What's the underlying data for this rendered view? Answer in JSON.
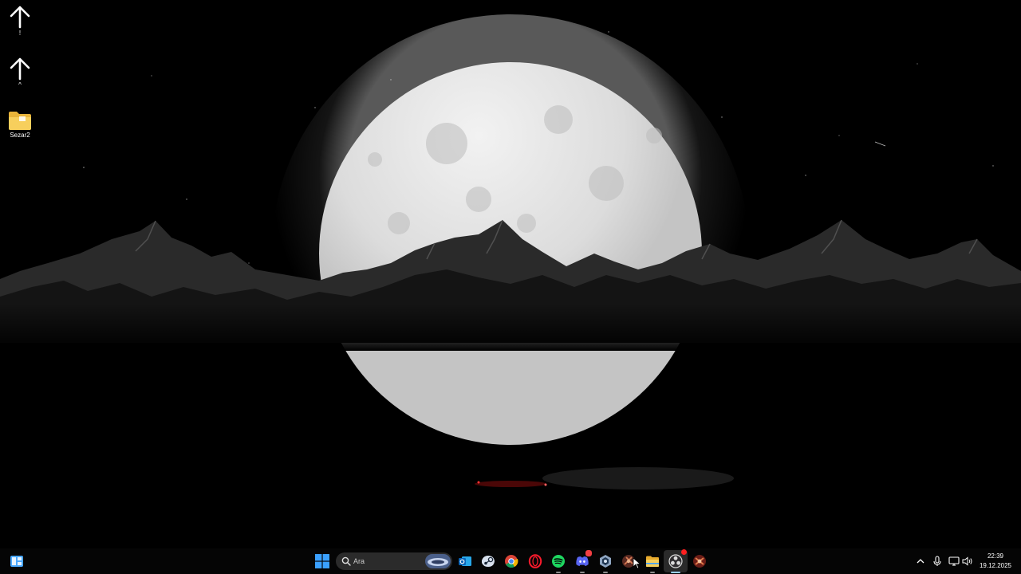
{
  "desktop": {
    "icons": [
      {
        "name": "upload-shortcut-1",
        "label": "!"
      },
      {
        "name": "upload-shortcut-2",
        "label": "^"
      },
      {
        "name": "folder",
        "label": "Sezar2"
      }
    ]
  },
  "taskbar": {
    "search": {
      "placeholder": "Ara"
    },
    "apps": [
      {
        "icon": "start-windows-icon",
        "running": false
      },
      {
        "icon": "outlook-icon",
        "running": false
      },
      {
        "icon": "steam-icon",
        "running": false
      },
      {
        "icon": "chrome-icon",
        "running": false
      },
      {
        "icon": "opera-gx-icon",
        "running": false
      },
      {
        "icon": "spotify-icon",
        "running": true
      },
      {
        "icon": "discord-icon",
        "running": true,
        "badge": true
      },
      {
        "icon": "vpn-shield-icon",
        "running": true
      },
      {
        "icon": "game-launcher-icon",
        "running": false
      },
      {
        "icon": "file-explorer-icon",
        "running": true
      },
      {
        "icon": "obs-studio-icon",
        "running": true,
        "active": true,
        "badge": true
      },
      {
        "icon": "game-icon",
        "running": false
      }
    ],
    "tray": {
      "icons": [
        "chevron-up-icon",
        "microphone-icon",
        "network-icon",
        "speaker-icon"
      ],
      "time": "22:39",
      "date": "19.12.2025"
    }
  },
  "colors": {
    "taskbar_bg": "#050505",
    "start_blue": "#3aa0ff",
    "folder_yellow": "#f2c64b",
    "spotify_green": "#1ed760",
    "discord_blurple": "#5865f2",
    "opera_red": "#ff1b2d"
  }
}
